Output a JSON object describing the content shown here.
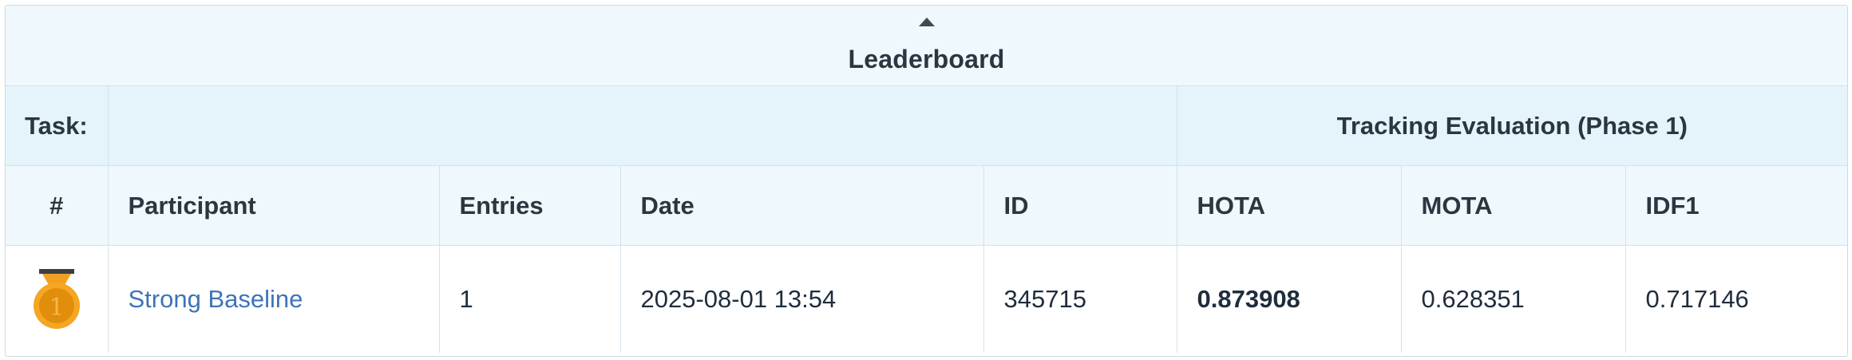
{
  "leaderboard": {
    "title": "Leaderboard",
    "sort_icon": "caret-up-icon"
  },
  "task": {
    "label": "Task:",
    "name": "Tracking Evaluation (Phase 1)"
  },
  "columns": [
    "#",
    "Participant",
    "Entries",
    "Date",
    "ID",
    "HOTA",
    "MOTA",
    "IDF1"
  ],
  "rows": [
    {
      "rank": "1",
      "rank_icon": "gold-medal-icon",
      "participant": "Strong Baseline",
      "entries": "1",
      "date": "2025-08-01 13:54",
      "id": "345715",
      "hota": "0.873908",
      "mota": "0.628351",
      "idf1": "0.717146"
    }
  ],
  "colors": {
    "header_bg": "#eef8fd",
    "task_bg": "#e5f4fb",
    "link": "#3d74b8",
    "medal_gold": "#f5a623",
    "medal_inner": "#e08e0b"
  }
}
